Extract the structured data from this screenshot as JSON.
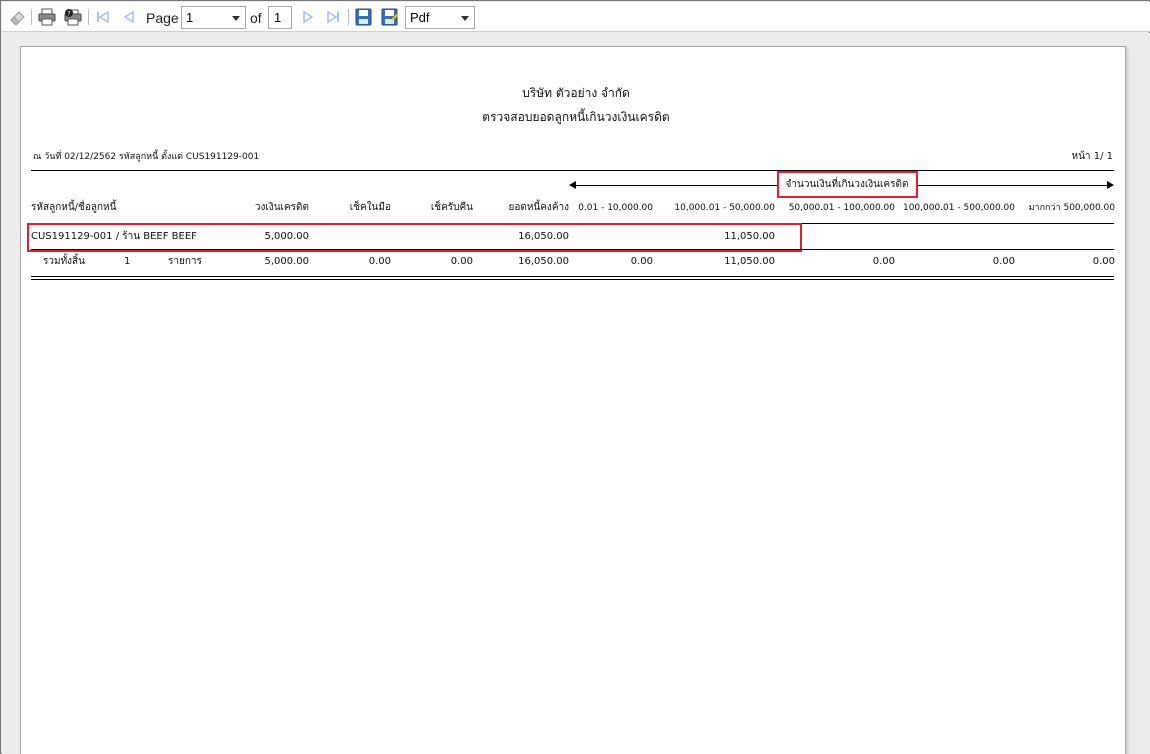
{
  "toolbar": {
    "page_label": "Page",
    "current_page": "1",
    "of_label": "of",
    "total_pages": "1",
    "export_format": "Pdf",
    "icons": [
      "eraser-icon",
      "print-icon",
      "print-settings-icon",
      "first-page-icon",
      "previous-page-icon",
      "next-page-icon",
      "last-page-icon",
      "save-icon",
      "save-as-icon"
    ]
  },
  "report": {
    "company": "บริษัท ตัวอย่าง จำกัด",
    "title": "ตรวจสอบยอดลูกหนี้เกินวงเงินเครดิต",
    "criteria": "ณ วันที่ 02/12/2562 รหัสลูกหนี้ ตั้งแต่ CUS191129-001",
    "page_info": "หน้า 1/ 1",
    "over_limit_caption": "จำนวนเงินที่เกินวงเงินเครดิต",
    "columns": {
      "customer": "รหัสลูกหนี้/ชื่อลูกหนี้",
      "credit_limit": "วงเงินเครดิต",
      "cheque_on_hand": "เช็คในมือ",
      "cheque_returned": "เช็ครับคืน",
      "outstanding": "ยอดหนี้คงค้าง",
      "range1": "0.01 - 10,000.00",
      "range2": "10,000.01 - 50,000.00",
      "range3": "50,000.01 - 100,000.00",
      "range4": "100,000.01 - 500,000.00",
      "range5": "มากกว่า 500,000.00"
    },
    "rows": [
      {
        "customer": "CUS191129-001 / ร้าน BEEF BEEF",
        "credit_limit": "5,000.00",
        "cheque_on_hand": "",
        "cheque_returned": "",
        "outstanding": "16,050.00",
        "range1": "",
        "range2": "11,050.00",
        "range3": "",
        "range4": "",
        "range5": ""
      }
    ],
    "total": {
      "label": "รวมทั้งสิ้น",
      "count": "1",
      "unit": "รายการ",
      "credit_limit": "5,000.00",
      "cheque_on_hand": "0.00",
      "cheque_returned": "0.00",
      "outstanding": "16,050.00",
      "range1": "0.00",
      "range2": "11,050.00",
      "range3": "0.00",
      "range4": "0.00",
      "range5": "0.00"
    }
  },
  "colors": {
    "highlight": "#e02032",
    "toolbar_icon_blue": "#3a6fb5"
  }
}
